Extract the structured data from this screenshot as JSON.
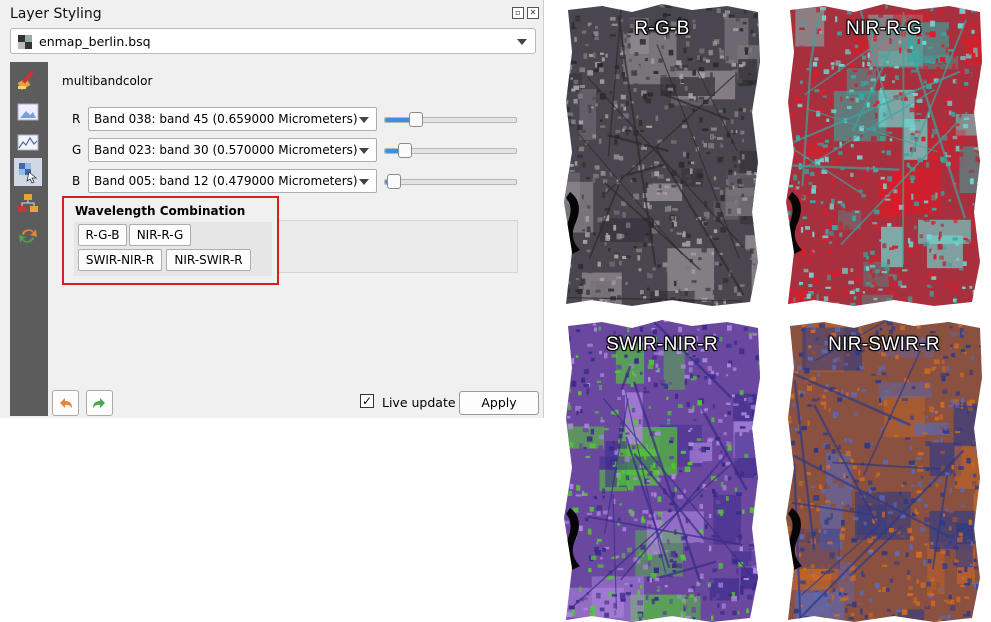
{
  "panel": {
    "title": "Layer Styling",
    "layer_name": "enmap_berlin.bsq",
    "renderer": "multibandcolor",
    "bands": [
      {
        "letter": "R",
        "label": "Band 038: band 45 (0.659000 Micrometers)",
        "slider_fraction": 0.24
      },
      {
        "letter": "G",
        "label": "Band 023: band 30 (0.570000 Micrometers)",
        "slider_fraction": 0.15
      },
      {
        "letter": "B",
        "label": "Band 005: band 12 (0.479000 Micrometers)",
        "slider_fraction": 0.07
      }
    ],
    "wavelength": {
      "title": "Wavelength Combination",
      "buttons": [
        "R-G-B",
        "NIR-R-G",
        "SWIR-NIR-R",
        "NIR-SWIR-R"
      ]
    },
    "live_update_label": "Live update",
    "live_update_checked": true,
    "live_update_mark": "✓",
    "apply_label": "Apply",
    "icons": [
      "paintbrush-icon",
      "image-icon",
      "histogram-icon",
      "raster-icon",
      "layer-tree-icon",
      "refresh-icon"
    ]
  },
  "maps": [
    {
      "label": "R-G-B",
      "palette": {
        "base": "#4a4650",
        "a": "#7d7880",
        "b": "#2c2a30",
        "c": "#a8a0a4"
      }
    },
    {
      "label": "NIR-R-G",
      "palette": {
        "base": "#a8303e",
        "a": "#e01a28",
        "b": "#3aa6a0",
        "c": "#6fd6cf"
      }
    },
    {
      "label": "SWIR-NIR-R",
      "palette": {
        "base": "#6a48a0",
        "a": "#52c834",
        "b": "#3a2a8a",
        "c": "#b088e0"
      }
    },
    {
      "label": "NIR-SWIR-R",
      "palette": {
        "base": "#8a5040",
        "a": "#d06a20",
        "b": "#2c3a8a",
        "c": "#5a6ab8"
      }
    }
  ],
  "colors": {
    "highlight": "#d51f1f",
    "slider_fill": "#3d8ee2",
    "toolbar": "#5c5c5c"
  }
}
